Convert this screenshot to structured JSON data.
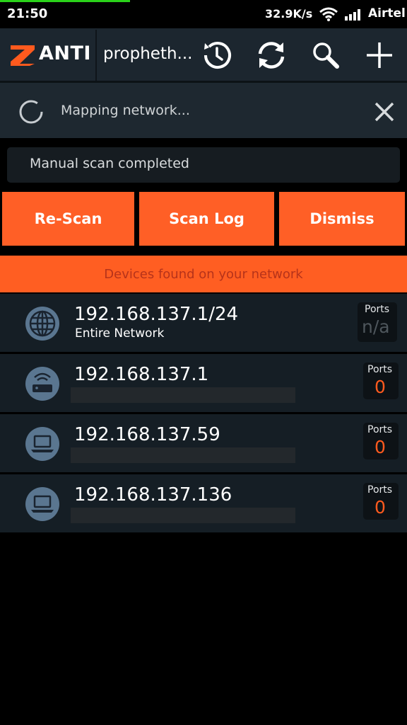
{
  "status_bar": {
    "time": "21:50",
    "speed": "32.9K/s",
    "carrier": "Airtel"
  },
  "action_bar": {
    "logo_text": "ANTI",
    "title": "propheth...",
    "icons": [
      "history-icon",
      "refresh-icon",
      "search-icon",
      "add-icon"
    ]
  },
  "mapping": {
    "text": "Mapping network..."
  },
  "scan_status": "Manual scan completed",
  "buttons": {
    "rescan": "Re-Scan",
    "scan_log": "Scan Log",
    "dismiss": "Dismiss"
  },
  "devices_banner": "Devices found on your network",
  "ports_label": "Ports",
  "devices": [
    {
      "ip": "192.168.137.1/24",
      "subtitle": "Entire Network",
      "icon": "globe-icon",
      "ports": "n/a"
    },
    {
      "ip": "192.168.137.1",
      "subtitle": "",
      "icon": "router-icon",
      "ports": "0"
    },
    {
      "ip": "192.168.137.59",
      "subtitle": "",
      "icon": "laptop-icon",
      "ports": "0"
    },
    {
      "ip": "192.168.137.136",
      "subtitle": "",
      "icon": "laptop-icon",
      "ports": "0"
    }
  ],
  "colors": {
    "accent": "#ff5f26",
    "background": "#000000",
    "row": "#151e25",
    "actionbar": "#1c262f"
  }
}
